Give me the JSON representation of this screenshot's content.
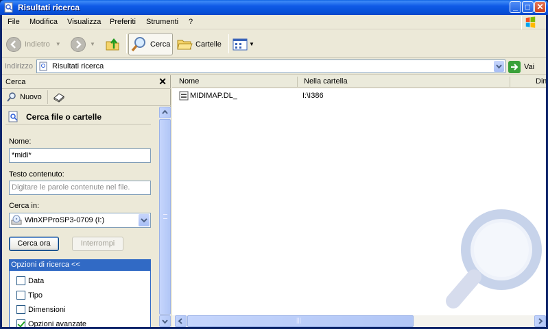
{
  "window": {
    "title": "Risultati ricerca"
  },
  "menu": [
    "File",
    "Modifica",
    "Visualizza",
    "Preferiti",
    "Strumenti",
    "?"
  ],
  "toolbar": {
    "back": "Indietro",
    "search": "Cerca",
    "folders": "Cartelle"
  },
  "address": {
    "label": "Indirizzo",
    "value": "Risultati ricerca",
    "go": "Vai"
  },
  "search_pane": {
    "header": "Cerca",
    "new_label": "Nuovo",
    "section_title": "Cerca file o cartelle",
    "name_label": "Nome:",
    "name_value": "*midi*",
    "content_label": "Testo contenuto:",
    "content_placeholder": "Digitare le parole contenute nel file.",
    "look_in_label": "Cerca in:",
    "look_in_value": "WinXPProSP3-0709 (I:)",
    "search_now": "Cerca ora",
    "stop": "Interrompi",
    "options_header": "Opzioni di ricerca <<",
    "options": [
      {
        "label": "Data",
        "checked": false
      },
      {
        "label": "Tipo",
        "checked": false
      },
      {
        "label": "Dimensioni",
        "checked": false
      },
      {
        "label": "Opzioni avanzate",
        "checked": true
      }
    ]
  },
  "results": {
    "columns": [
      "Nome",
      "Nella cartella",
      "Dim"
    ],
    "rows": [
      {
        "name": "MIDIMAP.DL_",
        "folder": "I:\\I386"
      }
    ],
    "hscroll_grip": "|||"
  },
  "colors": {
    "title_blue": "#0a5fe0",
    "selection_blue": "#316ac5",
    "face": "#ece9d8"
  }
}
